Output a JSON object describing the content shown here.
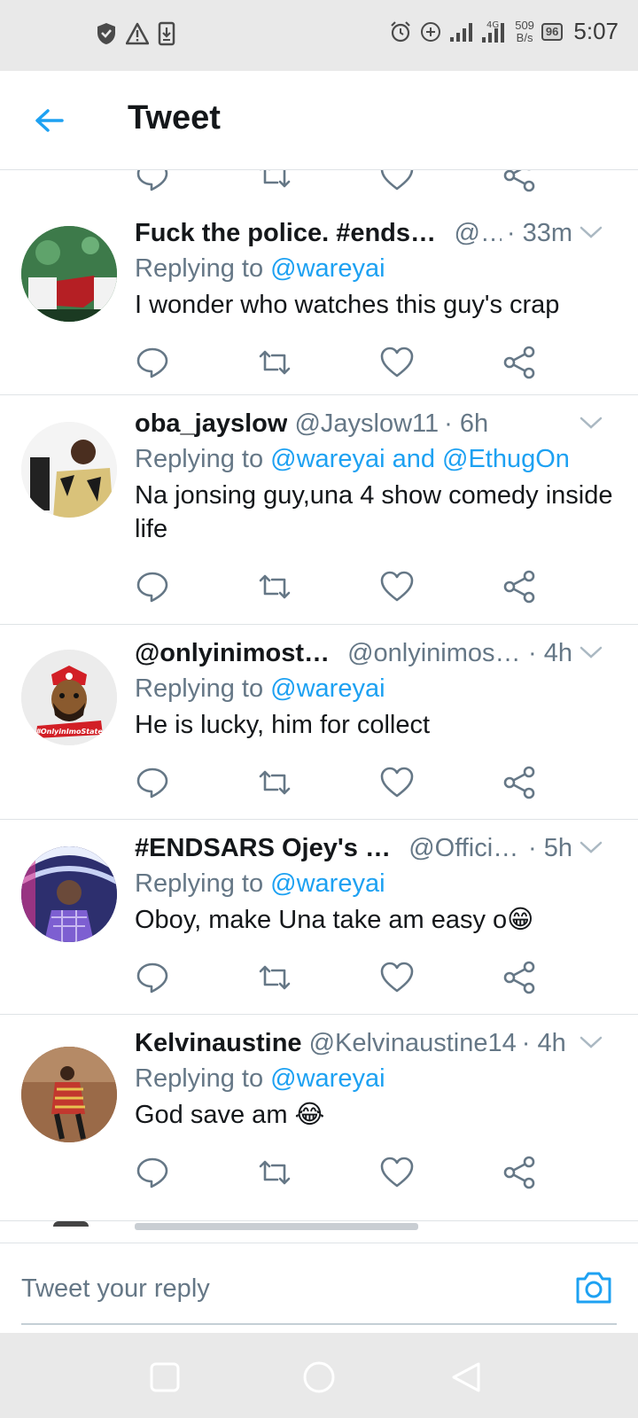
{
  "status_bar": {
    "left_icons": [
      "shield-icon",
      "warning-icon",
      "download-icon"
    ],
    "right_icons": [
      "alarm-icon",
      "add-circle-icon",
      "signal-icon",
      "signal-4g-icon"
    ],
    "net_speed_value": "509",
    "net_speed_unit": "B/s",
    "battery": "96",
    "time": "5:07"
  },
  "header": {
    "title": "Tweet"
  },
  "replying_label": "Replying to",
  "tweets": [
    {
      "name": "Fuck the police. #endsars",
      "handle": "@...",
      "time": "· 33m",
      "replying_to": "@wareyai",
      "text": "I wonder who watches this guy's crap"
    },
    {
      "name": "oba_jayslow",
      "handle": "@Jayslow11",
      "time": "· 6h",
      "replying_to": "@wareyai and @EthugOn",
      "text": "Na jonsing guy,una 4 show comedy inside life"
    },
    {
      "name": "@onlyinimostate",
      "handle": "@onlyinimost...",
      "time": "· 4h",
      "replying_to": "@wareyai",
      "text": "He is lucky, him for collect",
      "avatar_badge": "#OnlyinImoState"
    },
    {
      "name": "#ENDSARS Ojey's Law",
      "handle": "@Officia...",
      "time": "· 5h",
      "replying_to": "@wareyai",
      "text": "Oboy, make Una take am easy o😁"
    },
    {
      "name": "Kelvinaustine",
      "handle": "@Kelvinaustine14",
      "time": "· 4h",
      "replying_to": "@wareyai",
      "text": "God save am 😂"
    }
  ],
  "reply_bar": {
    "placeholder": "Tweet your reply"
  },
  "colors": {
    "accent": "#1da1f2",
    "secondary_text": "#657786",
    "primary_text": "#14171a",
    "system_bar": "#e9e9e9"
  }
}
